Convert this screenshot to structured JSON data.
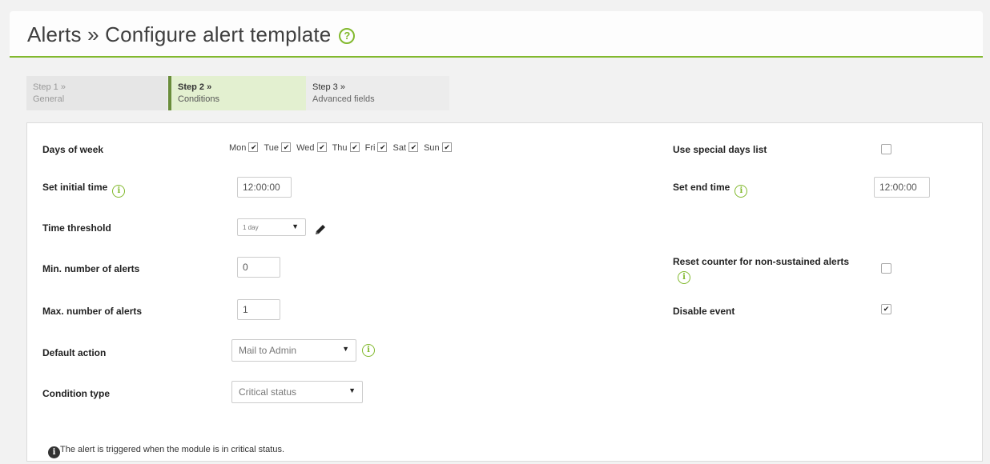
{
  "header": {
    "title": "Alerts » Configure alert template",
    "help_icon": "?"
  },
  "steps": [
    {
      "num": "Step 1 »",
      "name": "General"
    },
    {
      "num": "Step 2 »",
      "name": "Conditions"
    },
    {
      "num": "Step 3 »",
      "name": "Advanced fields"
    }
  ],
  "form": {
    "days_label": "Days of week",
    "days": [
      {
        "label": "Mon",
        "checked": true
      },
      {
        "label": "Tue",
        "checked": true
      },
      {
        "label": "Wed",
        "checked": true
      },
      {
        "label": "Thu",
        "checked": true
      },
      {
        "label": "Fri",
        "checked": true
      },
      {
        "label": "Sat",
        "checked": true
      },
      {
        "label": "Sun",
        "checked": true
      }
    ],
    "special_days_label": "Use special days list",
    "special_days_checked": false,
    "initial_time_label": "Set initial time",
    "initial_time_value": "12:00:00",
    "end_time_label": "Set end time",
    "end_time_value": "12:00:00",
    "threshold_label": "Time threshold",
    "threshold_value": "1 day",
    "min_alerts_label": "Min. number of alerts",
    "min_alerts_value": "0",
    "reset_counter_label": "Reset counter for non-sustained alerts",
    "reset_counter_checked": false,
    "max_alerts_label": "Max. number of alerts",
    "max_alerts_value": "1",
    "disable_event_label": "Disable event",
    "disable_event_checked": true,
    "default_action_label": "Default action",
    "default_action_value": "Mail to Admin",
    "condition_type_label": "Condition type",
    "condition_type_value": "Critical status",
    "note_icon": "i",
    "note_text": "The alert is triggered when the module is in critical status."
  },
  "icons": {
    "info": "i",
    "arrow": "▼"
  },
  "colors": {
    "accent": "#82b92e",
    "active_step_bg": "#e3f0d0"
  }
}
